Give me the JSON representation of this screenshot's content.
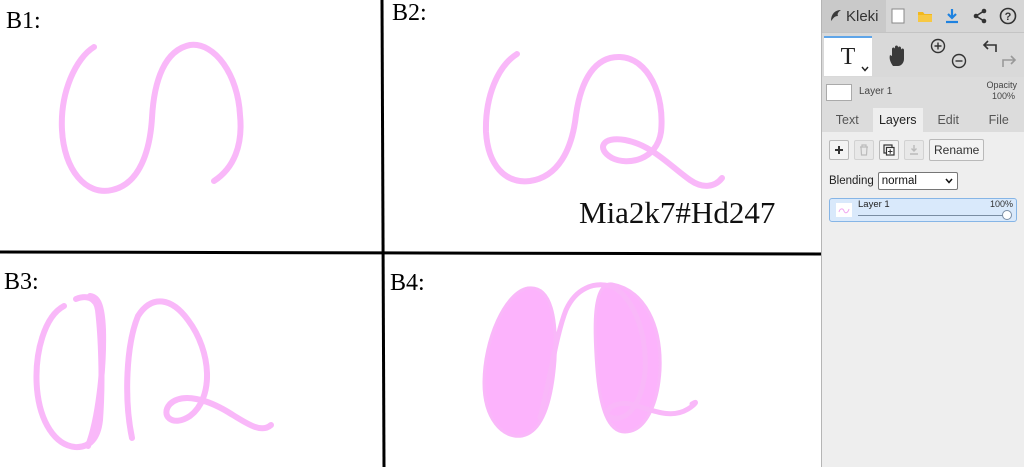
{
  "canvas": {
    "labels": {
      "b1": "B1:",
      "b2": "B2:",
      "b3": "B3:",
      "b4": "B4:"
    },
    "watermark": "Mia2k7#Hd247",
    "stroke_color": "#f9b8f9",
    "fill_color": "#fcb3fc",
    "divider_color": "#000000"
  },
  "app": {
    "name": "Kleki",
    "top_icons": [
      "new-image-icon",
      "open-file-icon",
      "download-icon",
      "share-icon",
      "help-icon"
    ],
    "accent": "#1e82e0"
  },
  "tools": {
    "text_tool": "T",
    "hand_tool": "hand-icon",
    "zoom_in": "zoom-in-icon",
    "zoom_out": "zoom-out-icon",
    "undo": "undo-icon",
    "redo": "redo-icon"
  },
  "layer_header": {
    "name": "Layer 1",
    "opacity_label": "Opacity",
    "opacity_value": "100%"
  },
  "tabs": [
    "Text",
    "Layers",
    "Edit",
    "File"
  ],
  "active_tab": "Layers",
  "layers_panel": {
    "rename_label": "Rename",
    "blending_label": "Blending",
    "blending_value": "normal",
    "layers": [
      {
        "name": "Layer 1",
        "opacity": "100%",
        "opacity_fraction": 1.0
      }
    ]
  }
}
